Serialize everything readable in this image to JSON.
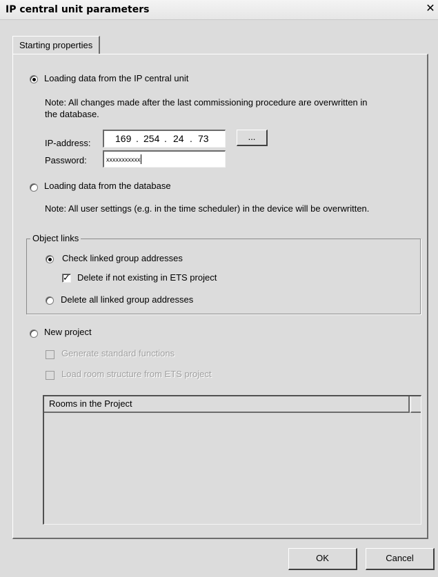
{
  "window": {
    "title": "IP central unit parameters",
    "close_label": "✕"
  },
  "tab": {
    "label": "Starting properties"
  },
  "load_ip": {
    "label": "Loading data from the IP central unit",
    "selected": true,
    "note_line1": "Note: All changes made after the last commissioning procedure are overwritten in",
    "note_line2": "the database.",
    "ip_label": "IP-address:",
    "ip_octets": [
      "169",
      "254",
      "24",
      "73"
    ],
    "browse_label": "...",
    "password_label": "Password:",
    "password_value": "xxxxxxxxxxx"
  },
  "load_db": {
    "label": "Loading data from the database",
    "selected": false,
    "note": "Note: All user settings (e.g. in the time scheduler) in the device will be overwritten."
  },
  "object_links": {
    "label": "Object links",
    "check_linked_label": "Check linked group addresses",
    "check_linked_selected": true,
    "delete_if_not_existing_label": "Delete if not existing in ETS project",
    "delete_if_not_existing_checked": true,
    "delete_all_label": "Delete all linked group addresses",
    "delete_all_selected": false
  },
  "new_project": {
    "label": "New project",
    "selected": false,
    "generate_standard_label": "Generate standard functions",
    "load_room_structure_label": "Load room structure from ETS project"
  },
  "rooms_list": {
    "header": "Rooms in the Project"
  },
  "buttons": {
    "ok": "OK",
    "cancel": "Cancel"
  }
}
